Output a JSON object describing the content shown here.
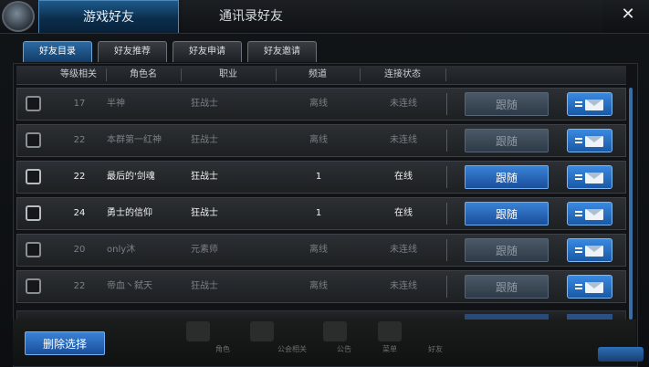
{
  "tabs": {
    "active": "游戏好友",
    "inactive": "通讯录好友"
  },
  "close_label": "✕",
  "subtabs": [
    {
      "label": "好友目录",
      "active": true
    },
    {
      "label": "好友推荐",
      "active": false
    },
    {
      "label": "好友申请",
      "active": false
    },
    {
      "label": "好友邀请",
      "active": false
    }
  ],
  "columns": {
    "level": "等级相关",
    "name": "角色名",
    "job": "职业",
    "channel": "频道",
    "status": "连接状态"
  },
  "rows": [
    {
      "level": "17",
      "name": "半神",
      "job": "狂战士",
      "channel": "离线",
      "status": "未连线",
      "online": false,
      "follow": "跟随"
    },
    {
      "level": "22",
      "name": "本群第一红神",
      "job": "狂战士",
      "channel": "离线",
      "status": "未连线",
      "online": false,
      "follow": "跟随"
    },
    {
      "level": "22",
      "name": "最后的'剑魂",
      "job": "狂战士",
      "channel": "1",
      "status": "在线",
      "online": true,
      "follow": "跟随"
    },
    {
      "level": "24",
      "name": "勇士的信仰",
      "job": "狂战士",
      "channel": "1",
      "status": "在线",
      "online": true,
      "follow": "跟随"
    },
    {
      "level": "20",
      "name": "only沐",
      "job": "元素师",
      "channel": "离线",
      "status": "未连线",
      "online": false,
      "follow": "跟随"
    },
    {
      "level": "22",
      "name": "帝血丶弑天",
      "job": "狂战士",
      "channel": "离线",
      "status": "未连线",
      "online": false,
      "follow": "跟随"
    }
  ],
  "delete_label": "删除选择",
  "scene_labels": [
    "角色",
    "公会相关",
    "公告",
    "菜单",
    "好友"
  ],
  "colors": {
    "accent": "#2f78cc",
    "online_text": "#f0f2f4",
    "offline_text": "#7b8086"
  }
}
